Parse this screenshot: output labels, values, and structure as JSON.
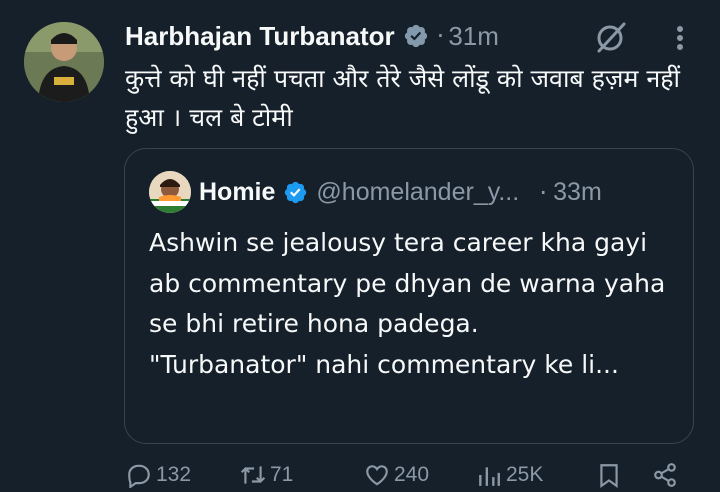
{
  "tweet": {
    "author_name": "Harbhajan Turbanator",
    "time": "31m",
    "separator": "·",
    "text": "कुत्ते को घी नहीं पचता और तेरे जैसे लोंडू को जवाब हज़म नहीं हुआ । चल बे टोमी"
  },
  "quoted": {
    "author_name": "Homie",
    "handle": "@homelander_y...",
    "separator": "·",
    "time": "33m",
    "text": "Ashwin se jealousy tera career kha gayi ab commentary pe dhyan de warna yaha se bhi retire hona padega.\n\"Turbanator\" nahi commentary ke li..."
  },
  "actions": {
    "replies": "132",
    "reposts": "71",
    "likes": "240",
    "views": "25K"
  },
  "colors": {
    "background": "#15202b",
    "text_primary": "#f7f9f9",
    "text_secondary": "#8b98a5",
    "verified_blue": "#1d9bf0",
    "verified_gray": "#829aab",
    "border": "#38444d"
  },
  "icons": [
    "grok-icon",
    "more-icon",
    "verified-gray-icon",
    "verified-blue-icon",
    "reply-icon",
    "repost-icon",
    "like-icon",
    "views-icon",
    "bookmark-icon",
    "share-icon"
  ]
}
